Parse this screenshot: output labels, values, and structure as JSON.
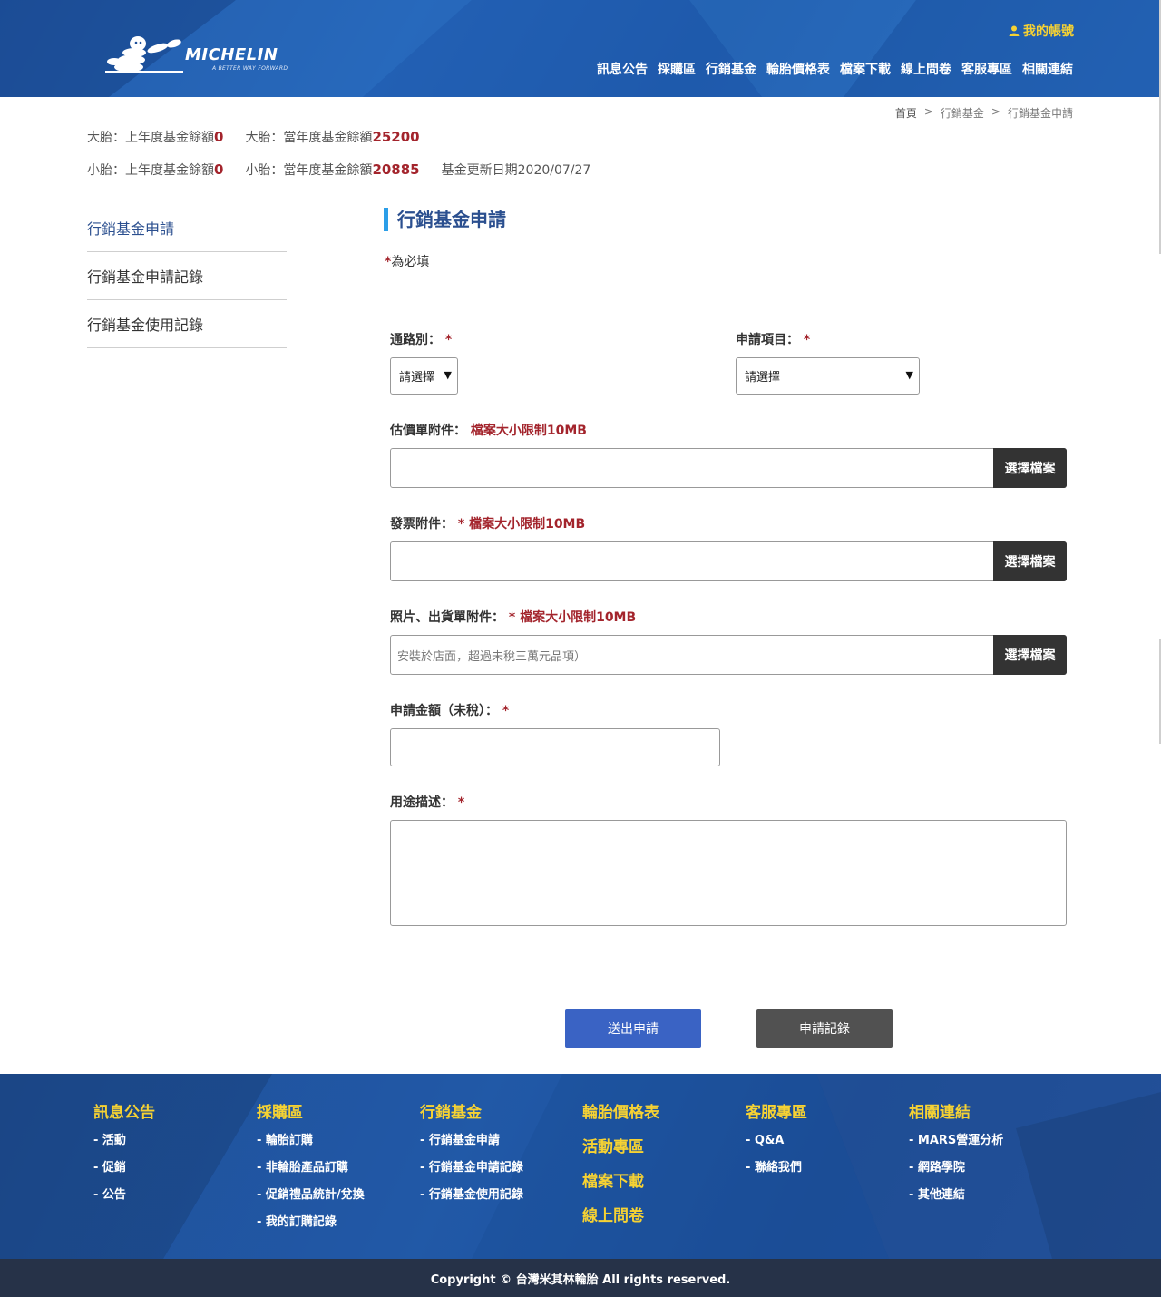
{
  "header": {
    "logo_text": "MICHELIN",
    "logo_tagline": "A BETTER WAY FORWARD",
    "account_label": "我的帳號",
    "nav": [
      "訊息公告",
      "採購區",
      "行銷基金",
      "輪胎價格表",
      "檔案下載",
      "線上問卷",
      "客服專區",
      "相關連結"
    ]
  },
  "breadcrumb": [
    "首頁",
    ">",
    "行銷基金",
    ">",
    "行銷基金申請"
  ],
  "fund": {
    "big_prev_label": "大胎：上年度基金餘額",
    "big_prev_value": "0",
    "big_curr_label": "大胎：當年度基金餘額",
    "big_curr_value": "25200",
    "small_prev_label": "小胎：上年度基金餘額",
    "small_prev_value": "0",
    "small_curr_label": "小胎：當年度基金餘額",
    "small_curr_value": "20885",
    "update_label": "基金更新日期2020/07/27"
  },
  "sidebar": [
    "行銷基金申請",
    "行銷基金申請記錄",
    "行銷基金使用記錄"
  ],
  "form": {
    "title": "行銷基金申請",
    "required_star": "*",
    "required_note": "為必填",
    "channel_label": "通路別：",
    "channel_value": "請選擇",
    "item_label": "申請項目：",
    "item_value": "請選擇",
    "quote_label": "估價單附件：",
    "size_limit": "檔案大小限制10MB",
    "invoice_label": "發票附件：",
    "photo_label": "照片、出貨單附件：",
    "photo_placeholder": "安裝於店面，超過未稅三萬元品項）",
    "choose_file": "選擇檔案",
    "amount_label": "申請金額（未稅）：",
    "usage_label": "用途描述：",
    "submit": "送出申請",
    "records": "申請記錄"
  },
  "footer": {
    "col1": {
      "title": "訊息公告",
      "links": [
        "- 活動",
        "- 促銷",
        "- 公告"
      ]
    },
    "col2": {
      "title": "採購區",
      "links": [
        "- 輪胎訂購",
        "- 非輪胎產品訂購",
        "- 促銷禮品統計/兌換",
        "- 我的訂購記錄"
      ]
    },
    "col3": {
      "title": "行銷基金",
      "links": [
        "- 行銷基金申請",
        "- 行銷基金申請記錄",
        "- 行銷基金使用記錄"
      ]
    },
    "col4": {
      "links": [
        "輪胎價格表",
        "活動專區",
        "檔案下載",
        "線上問卷"
      ]
    },
    "col5": {
      "title": "客服專區",
      "links": [
        "- Q&A",
        "- 聯絡我們"
      ]
    },
    "col6": {
      "title": "相關連結",
      "links": [
        "- MARS營運分析",
        "- 網路學院",
        "- 其他連結"
      ]
    },
    "copyright": "Copyright © 台灣米其林輪胎 All rights reserved."
  },
  "colors": {
    "header_blue": "#2566b8",
    "accent_yellow": "#f6d233",
    "required_red": "#a3242c",
    "title_blue": "#2b4f8f",
    "submit_blue": "#3a63c4",
    "records_gray": "#515151",
    "copyright_bg": "#263248"
  }
}
